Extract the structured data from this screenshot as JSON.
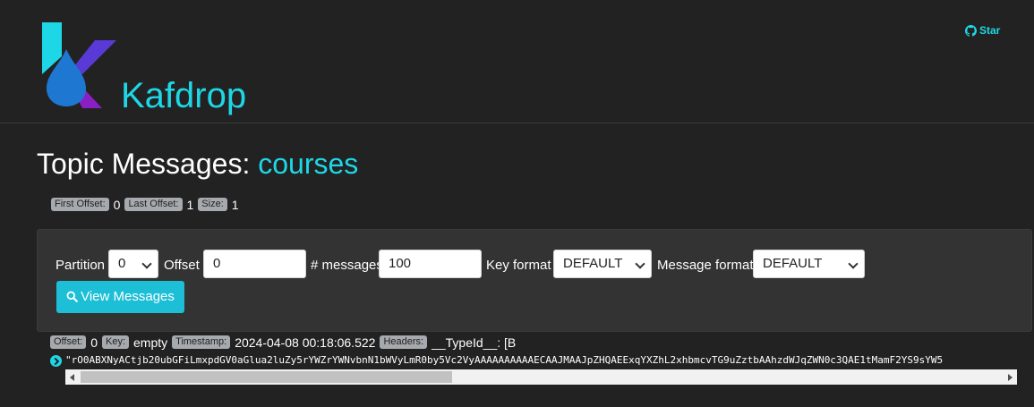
{
  "header": {
    "brand": "Kafdrop",
    "star_label": "Star",
    "colors": {
      "accent": "#1ed7e6",
      "logo_blue": "#1e78d2",
      "logo_indigo": "#5a3ad6",
      "logo_purple": "#8a1fc4"
    }
  },
  "page": {
    "title_prefix": "Topic Messages:",
    "topic": "courses"
  },
  "offsets": {
    "first_label": "First Offset:",
    "first_value": "0",
    "last_label": "Last Offset:",
    "last_value": "1",
    "size_label": "Size:",
    "size_value": "1"
  },
  "filter": {
    "partition_label": "Partition",
    "partition_value": "0",
    "offset_label": "Offset",
    "offset_value": "0",
    "messages_label": "# messages",
    "messages_value": "100",
    "key_format_label": "Key format",
    "key_format_value": "DEFAULT",
    "message_format_label": "Message format",
    "message_format_value": "DEFAULT",
    "view_button": "View Messages"
  },
  "message": {
    "offset_label": "Offset:",
    "offset_value": "0",
    "key_label": "Key:",
    "key_value": "empty",
    "timestamp_label": "Timestamp:",
    "timestamp_value": "2024-04-08 00:18:06.522",
    "headers_label": "Headers:",
    "headers_value": "__TypeId__: [B",
    "body": "\"rO0ABXNyACtjb20ubGFiLmxpdGV0aGlua2luZy5rYWZrYWNvbnN1bWVyLmR0by5Vc2VyAAAAAAAAAAECAAJMAAJpZHQAEExqYXZhL2xhbmcvTG9uZztbAAhzdWJqZWN0c3QAE1tMamF2YS9sYW5"
  }
}
